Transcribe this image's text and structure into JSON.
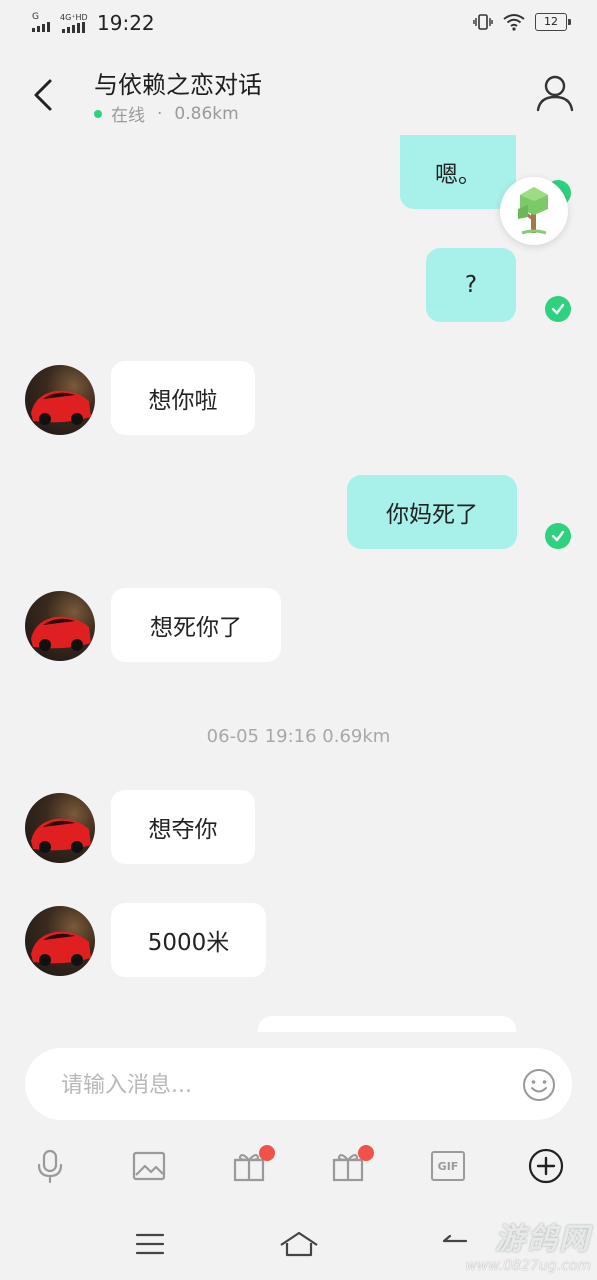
{
  "status_bar": {
    "network_1": "G",
    "network_2": "4G⁺HD",
    "time": "19:22",
    "battery": "12"
  },
  "header": {
    "title": "与依赖之恋对话",
    "status": "在线",
    "separator": "·",
    "distance": "0.86km"
  },
  "messages": [
    {
      "side": "out",
      "text": "嗯。",
      "read": true
    },
    {
      "side": "out",
      "text": "?",
      "read": true
    },
    {
      "side": "in",
      "text": "想你啦"
    },
    {
      "side": "out",
      "text": "你妈死了",
      "read": true
    },
    {
      "side": "in",
      "text": "想死你了"
    },
    {
      "side": "timestamp",
      "text": "06-05 19:16  0.69km"
    },
    {
      "side": "in",
      "text": "想夺你"
    },
    {
      "side": "in",
      "text": "5000米"
    },
    {
      "side": "out",
      "text": ""
    }
  ],
  "input": {
    "placeholder": "请输入消息..."
  },
  "toolbar": {
    "items": [
      "mic-icon",
      "image-icon",
      "gift-icon",
      "gift-icon",
      "gif-icon",
      "plus-icon"
    ],
    "gif_label": "GIF"
  },
  "watermark": {
    "main": "游鸽网",
    "sub": "www.0827ug.com"
  },
  "colors": {
    "outgoing_bubble": "#a8f0ea",
    "incoming_bubble": "#ffffff",
    "online_dot": "#2ed17d",
    "badge": "#f0524a",
    "background": "#f2f2f2"
  }
}
